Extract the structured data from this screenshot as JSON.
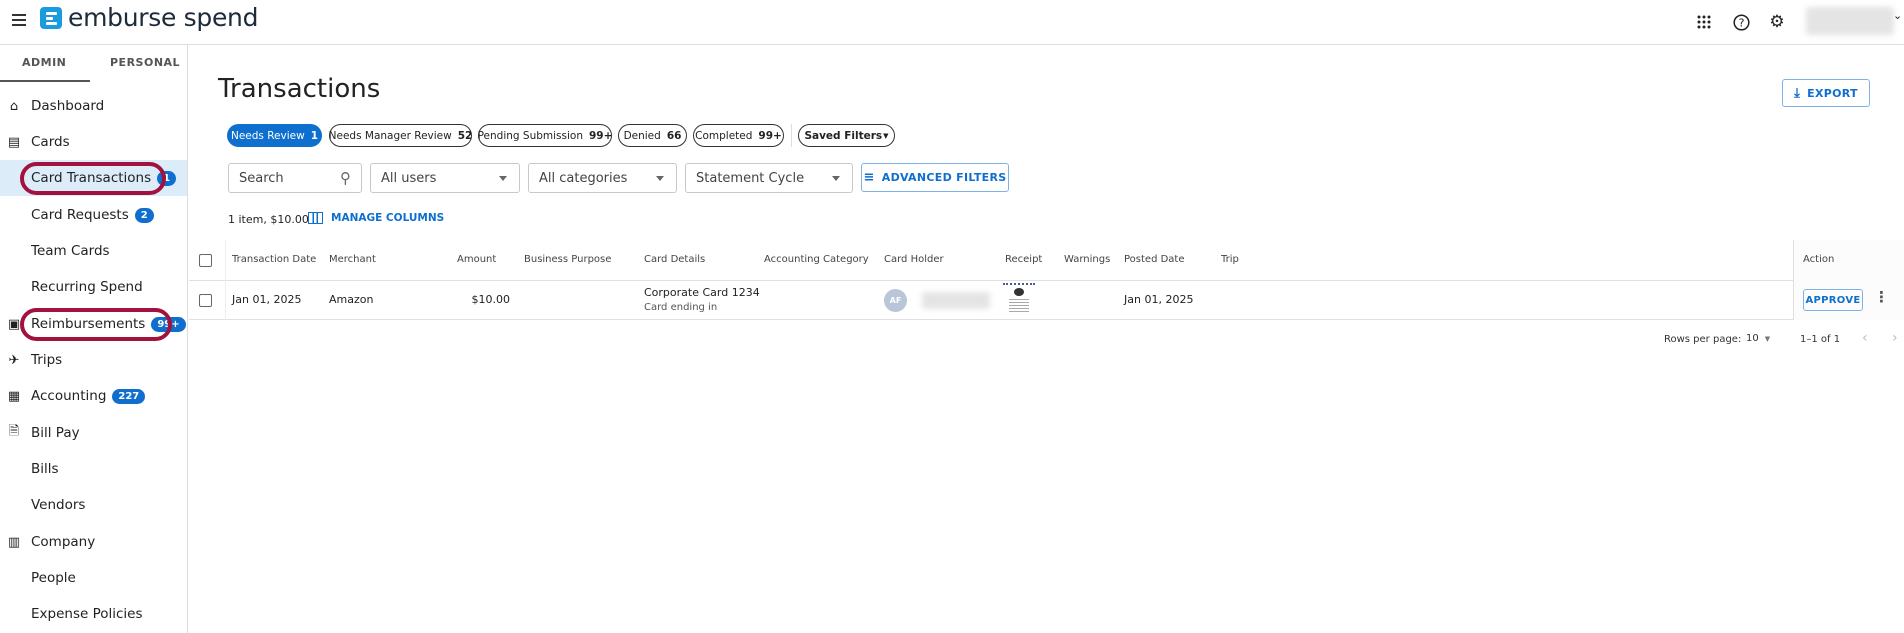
{
  "header": {
    "brand": "emburse spend",
    "icons": [
      "menu-icon",
      "apps-grid-icon",
      "help-icon",
      "settings-gear-icon",
      "chevron-down-icon"
    ]
  },
  "sidebar": {
    "tabs": [
      "ADMIN",
      "PERSONAL"
    ],
    "items": [
      {
        "label": "Dashboard",
        "icon": "home-icon"
      },
      {
        "label": "Cards",
        "icon": "cards-icon"
      },
      {
        "label": "Card Transactions",
        "badge": "1",
        "selected": true
      },
      {
        "label": "Card Requests",
        "badge": "2"
      },
      {
        "label": "Team Cards"
      },
      {
        "label": "Recurring Spend"
      },
      {
        "label": "Reimbursements",
        "badge": "99+",
        "icon": "cash-icon"
      },
      {
        "label": "Trips",
        "icon": "plane-icon"
      },
      {
        "label": "Accounting",
        "badge": "227",
        "icon": "calculator-icon"
      },
      {
        "label": "Bill Pay",
        "icon": "bill-icon"
      },
      {
        "label": "Bills"
      },
      {
        "label": "Vendors"
      },
      {
        "label": "Company",
        "icon": "building-icon"
      },
      {
        "label": "People"
      },
      {
        "label": "Expense Policies"
      }
    ],
    "highlight_color": "#a3123f"
  },
  "main": {
    "title": "Transactions",
    "export_label": "EXPORT",
    "status_chips": [
      {
        "label": "Needs Review",
        "count": "1",
        "active": true
      },
      {
        "label": "Needs Manager Review",
        "count": "52"
      },
      {
        "label": "Pending Submission",
        "count": "99+"
      },
      {
        "label": "Denied",
        "count": "66"
      },
      {
        "label": "Completed",
        "count": "99+"
      }
    ],
    "saved_filters": "Saved Filters",
    "filters": {
      "search_placeholder": "Search",
      "users": "All users",
      "categories": "All categories",
      "statement": "Statement Cycle",
      "advanced": "ADVANCED FILTERS"
    },
    "summary": "1 item, $10.00",
    "manage_columns": "MANAGE COLUMNS",
    "columns": [
      "Transaction Date",
      "Merchant",
      "Amount",
      "Business Purpose",
      "Card Details",
      "Accounting Category",
      "Card Holder",
      "Receipt",
      "Warnings",
      "Posted Date",
      "Trip",
      "Action"
    ],
    "rows": [
      {
        "date": "Jan 01, 2025",
        "merchant": "Amazon",
        "amount": "$10.00",
        "card": "Corporate Card 1234",
        "card_sub": "Card ending in",
        "holder_initials": "AF",
        "posted": "Jan 01, 2025",
        "action": "APPROVE"
      }
    ],
    "pagination": {
      "rows_label": "Rows per page:",
      "rows_value": "10",
      "range": "1–1 of 1"
    },
    "accent": "#0f6fcf"
  }
}
